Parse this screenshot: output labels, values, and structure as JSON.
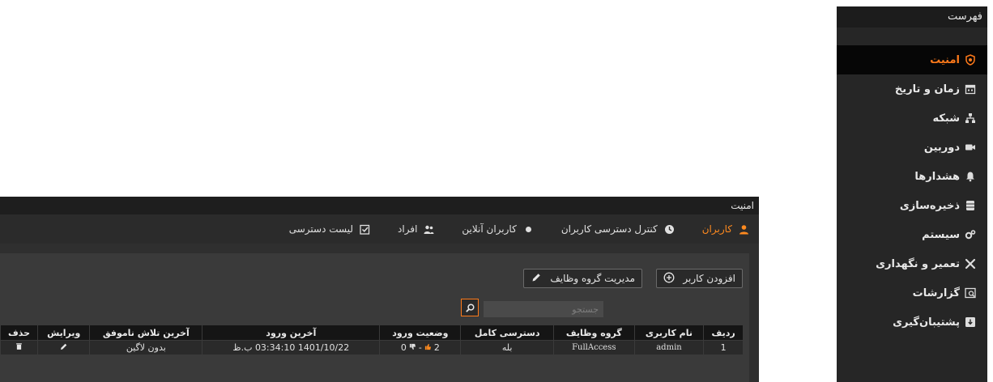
{
  "sidebar": {
    "title": "فهرست",
    "items": [
      {
        "label": "امنیت",
        "icon": "shield-icon"
      },
      {
        "label": "زمان و تاریخ",
        "icon": "calendar-icon"
      },
      {
        "label": "شبکه",
        "icon": "network-icon"
      },
      {
        "label": "دوربین",
        "icon": "camera-icon"
      },
      {
        "label": "هشدارها",
        "icon": "bell-icon"
      },
      {
        "label": "ذخیره‌سازی",
        "icon": "storage-icon"
      },
      {
        "label": "سیستم",
        "icon": "gears-icon"
      },
      {
        "label": "تعمیر و نگهداری",
        "icon": "tools-icon"
      },
      {
        "label": "گزارشات",
        "icon": "report-icon"
      },
      {
        "label": "پشتیبان‌گیری",
        "icon": "backup-icon"
      }
    ]
  },
  "panel": {
    "title": "امنیت",
    "tabs": [
      {
        "label": "کاربران",
        "icon": "user-icon"
      },
      {
        "label": "کنترل دسترسی کاربران",
        "icon": "access-control-icon"
      },
      {
        "label": "کاربران آنلاین",
        "icon": "online-dot-icon"
      },
      {
        "label": "افراد",
        "icon": "people-icon"
      },
      {
        "label": "لیست دسترسی",
        "icon": "checklist-icon"
      }
    ],
    "add_user_label": "افزودن کاربر",
    "manage_groups_label": "مدیریت گروه وظایف",
    "search_placeholder": "جستجو"
  },
  "table": {
    "headers": [
      "ردیف",
      "نام کاربری",
      "گروه وظایف",
      "دسترسی کامل",
      "وضعیت ورود",
      "آخرین ورود",
      "آخرین تلاش ناموفق",
      "ویرایش",
      "حذف"
    ],
    "rows": [
      {
        "index": "1",
        "username": "admin",
        "group": "FullAccess",
        "full_access": "بله",
        "login_up": "2",
        "login_down": "0",
        "last_login": "1401/10/22 03:34:10 ب.ظ",
        "last_failed": "بدون لاگین"
      }
    ]
  },
  "colors": {
    "accent": "#ff7a1a",
    "panel_bg": "#2f2f2f",
    "sidebar_bg": "#262626"
  }
}
